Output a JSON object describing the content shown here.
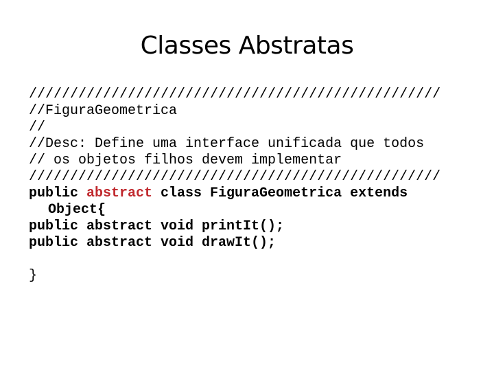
{
  "slide": {
    "title": "Classes Abstratas",
    "comment_lines": [
      "//////////////////////////////////////////////////",
      "//FiguraGeometrica",
      "//",
      "//Desc: Define uma interface unificada que todos",
      "// os objetos filhos devem implementar",
      "//////////////////////////////////////////////////"
    ],
    "class_decl": {
      "public": "public ",
      "abstract": "abstract",
      "rest": " class FiguraGeometrica extends",
      "continuation": "Object{"
    },
    "methods": [
      "public abstract void printIt();",
      "public abstract void drawIt();"
    ],
    "closing_brace": "}",
    "highlight_color": "#c0282d"
  }
}
